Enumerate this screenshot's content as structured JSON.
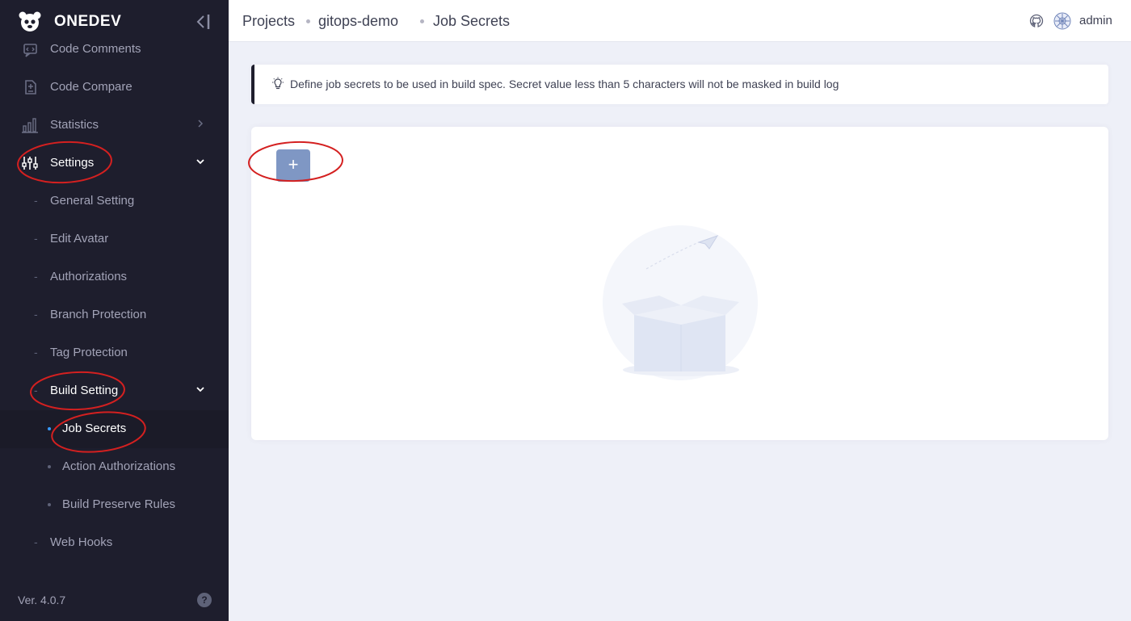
{
  "app": {
    "name": "ONEDEV",
    "version": "Ver. 4.0.7"
  },
  "sidebar": {
    "items": [
      {
        "label": "Code Comments",
        "icon": "code-comments-icon"
      },
      {
        "label": "Code Compare",
        "icon": "code-compare-icon"
      },
      {
        "label": "Statistics",
        "icon": "statistics-icon"
      },
      {
        "label": "Settings",
        "icon": "settings-sliders-icon"
      },
      {
        "label": "General Setting"
      },
      {
        "label": "Edit Avatar"
      },
      {
        "label": "Authorizations"
      },
      {
        "label": "Branch Protection"
      },
      {
        "label": "Tag Protection"
      },
      {
        "label": "Build Setting"
      },
      {
        "label": "Job Secrets"
      },
      {
        "label": "Action Authorizations"
      },
      {
        "label": "Build Preserve Rules"
      },
      {
        "label": "Web Hooks"
      }
    ]
  },
  "header": {
    "breadcrumbs": [
      "Projects",
      "gitops-demo",
      "Job Secrets"
    ],
    "user": "admin"
  },
  "alert": {
    "text": "Define job secrets to be used in build spec. Secret value less than 5 characters will not be masked in build log"
  },
  "toolbar": {
    "add_label": "+"
  },
  "colors": {
    "sidebar_bg": "#1e1e2d",
    "page_bg": "#eef0f8",
    "add_button": "#7f97c4",
    "annotation": "#d42020"
  }
}
